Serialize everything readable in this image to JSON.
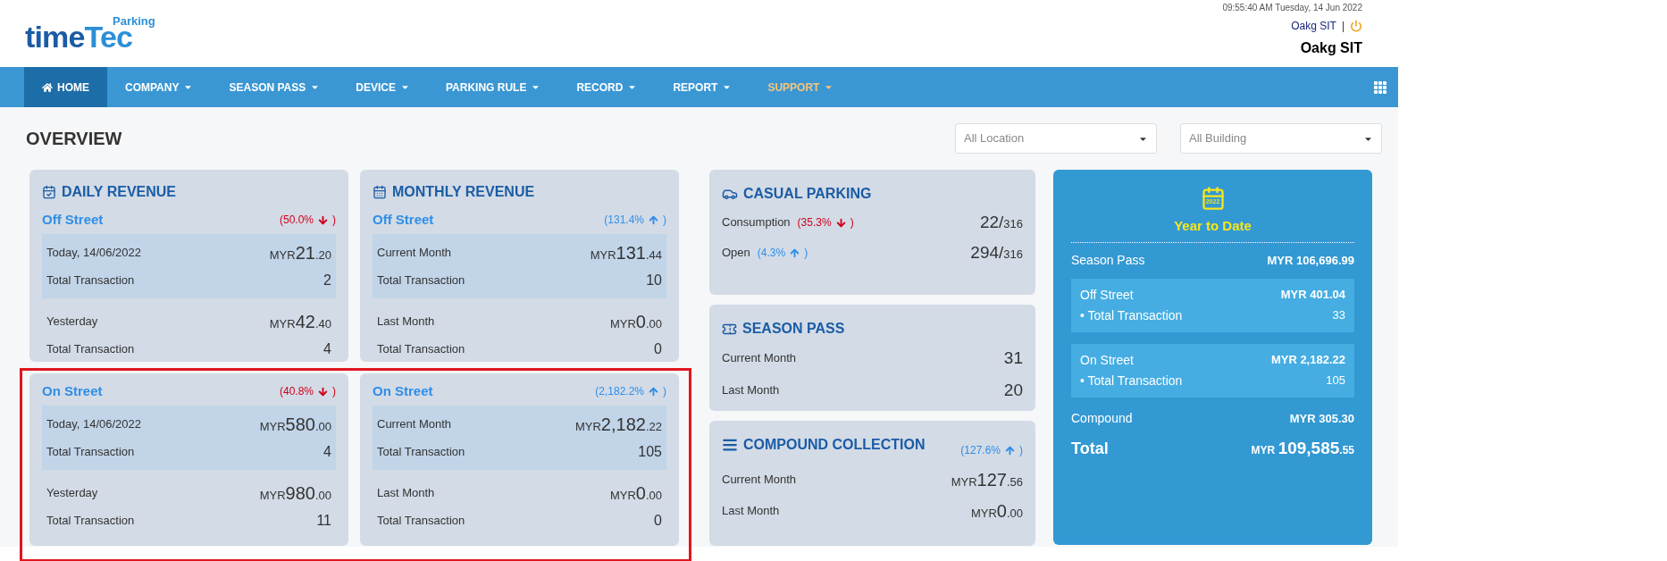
{
  "header": {
    "logo": {
      "part_one": "time",
      "part_two": "Tec",
      "badge": "Parking"
    },
    "datetime": "09:55:40 AM Tuesday, 14 Jun 2022",
    "user": "Oakg SIT",
    "separator": "|",
    "company": "Oakg SIT"
  },
  "nav": {
    "items": [
      {
        "label": "HOME",
        "selected": true,
        "dropdown": false,
        "color": "#ffffff"
      },
      {
        "label": "COMPANY",
        "selected": false,
        "dropdown": true,
        "color": "#ffffff"
      },
      {
        "label": "SEASON PASS",
        "selected": false,
        "dropdown": true,
        "color": "#ffffff"
      },
      {
        "label": "DEVICE",
        "selected": false,
        "dropdown": true,
        "color": "#ffffff"
      },
      {
        "label": "PARKING RULE",
        "selected": false,
        "dropdown": true,
        "color": "#ffffff"
      },
      {
        "label": "RECORD",
        "selected": false,
        "dropdown": true,
        "color": "#ffffff"
      },
      {
        "label": "REPORT",
        "selected": false,
        "dropdown": true,
        "color": "#ffffff"
      },
      {
        "label": "SUPPORT",
        "selected": false,
        "dropdown": true,
        "color": "#f7c57a"
      }
    ]
  },
  "overview": {
    "title": "OVERVIEW",
    "filters": [
      {
        "value": "All Location"
      },
      {
        "value": "All Building"
      }
    ]
  },
  "revenue_columns": [
    {
      "title": "DAILY REVENUE",
      "blocks": [
        {
          "name": "Off Street",
          "change": "(50.0%",
          "close": ")",
          "increase": false,
          "groups": [
            {
              "highlighted": true,
              "rows": [
                {
                  "label": "Today, 14/06/2022",
                  "currency": "MYR",
                  "integer": "21",
                  "decimals": ".20"
                },
                {
                  "label": "Total Transaction",
                  "value": "2"
                }
              ]
            },
            {
              "highlighted": false,
              "rows": [
                {
                  "label": "Yesterday",
                  "currency": "MYR",
                  "integer": "42",
                  "decimals": ".40"
                },
                {
                  "label": "Total Transaction",
                  "value": "4"
                }
              ]
            }
          ]
        },
        {
          "name": "On Street",
          "change": "(40.8%",
          "close": ")",
          "increase": false,
          "groups": [
            {
              "highlighted": true,
              "rows": [
                {
                  "label": "Today, 14/06/2022",
                  "currency": "MYR",
                  "integer": "580",
                  "decimals": ".00"
                },
                {
                  "label": "Total Transaction",
                  "value": "4"
                }
              ]
            },
            {
              "highlighted": false,
              "rows": [
                {
                  "label": "Yesterday",
                  "currency": "MYR",
                  "integer": "980",
                  "decimals": ".00"
                },
                {
                  "label": "Total Transaction",
                  "value": "11"
                }
              ]
            }
          ]
        }
      ]
    },
    {
      "title": "MONTHLY REVENUE",
      "blocks": [
        {
          "name": "Off Street",
          "change": "(131.4%",
          "close": ")",
          "increase": true,
          "groups": [
            {
              "highlighted": true,
              "rows": [
                {
                  "label": "Current Month",
                  "currency": "MYR",
                  "integer": "131",
                  "decimals": ".44"
                },
                {
                  "label": "Total Transaction",
                  "value": "10"
                }
              ]
            },
            {
              "highlighted": false,
              "rows": [
                {
                  "label": "Last Month",
                  "currency": "MYR",
                  "integer": "0",
                  "decimals": ".00"
                },
                {
                  "label": "Total Transaction",
                  "value": "0"
                }
              ]
            }
          ]
        },
        {
          "name": "On Street",
          "change": "(2,182.2%",
          "close": ")",
          "increase": true,
          "groups": [
            {
              "highlighted": true,
              "rows": [
                {
                  "label": "Current Month",
                  "currency": "MYR",
                  "integer": "2,182",
                  "decimals": ".22"
                },
                {
                  "label": "Total Transaction",
                  "value": "105"
                }
              ]
            },
            {
              "highlighted": false,
              "rows": [
                {
                  "label": "Last Month",
                  "currency": "MYR",
                  "integer": "0",
                  "decimals": ".00"
                },
                {
                  "label": "Total Transaction",
                  "value": "0"
                }
              ]
            }
          ]
        }
      ]
    }
  ],
  "casual_parking": {
    "title": "CASUAL PARKING",
    "rows": [
      {
        "label": "Consumption",
        "change": "(35.3%",
        "close": ")",
        "increase": false,
        "value": "22/",
        "total": "316"
      },
      {
        "label": "Open",
        "change": "(4.3%",
        "close": ")",
        "increase": true,
        "value": "294/",
        "total": "316"
      }
    ]
  },
  "season_pass": {
    "title": "SEASON PASS",
    "rows": [
      {
        "label": "Current Month",
        "value": "31"
      },
      {
        "label": "Last Month",
        "value": "20"
      }
    ]
  },
  "compound_collection": {
    "title": "COMPOUND COLLECTION",
    "change": "(127.6%",
    "close": ")",
    "increase": true,
    "rows": [
      {
        "label": "Current Month",
        "currency": "MYR",
        "integer": "127",
        "decimals": ".56"
      },
      {
        "label": "Last Month",
        "currency": "MYR",
        "integer": "0",
        "decimals": ".00"
      }
    ]
  },
  "year_to_date": {
    "year": "2022",
    "title": "Year to Date",
    "season_pass": {
      "label": "Season Pass",
      "value": "MYR 106,696.99"
    },
    "groups": [
      {
        "name": "Off Street",
        "amount": "MYR 401.04",
        "sub_label": "• Total Transaction",
        "sub_value": "33"
      },
      {
        "name": "On Street",
        "amount": "MYR 2,182.22",
        "sub_label": "• Total Transaction",
        "sub_value": "105"
      }
    ],
    "compound": {
      "label": "Compound",
      "value": "MYR 305.30"
    },
    "total": {
      "label": "Total",
      "currency": "MYR",
      "integer": "109,585",
      "decimals": ".55"
    }
  }
}
